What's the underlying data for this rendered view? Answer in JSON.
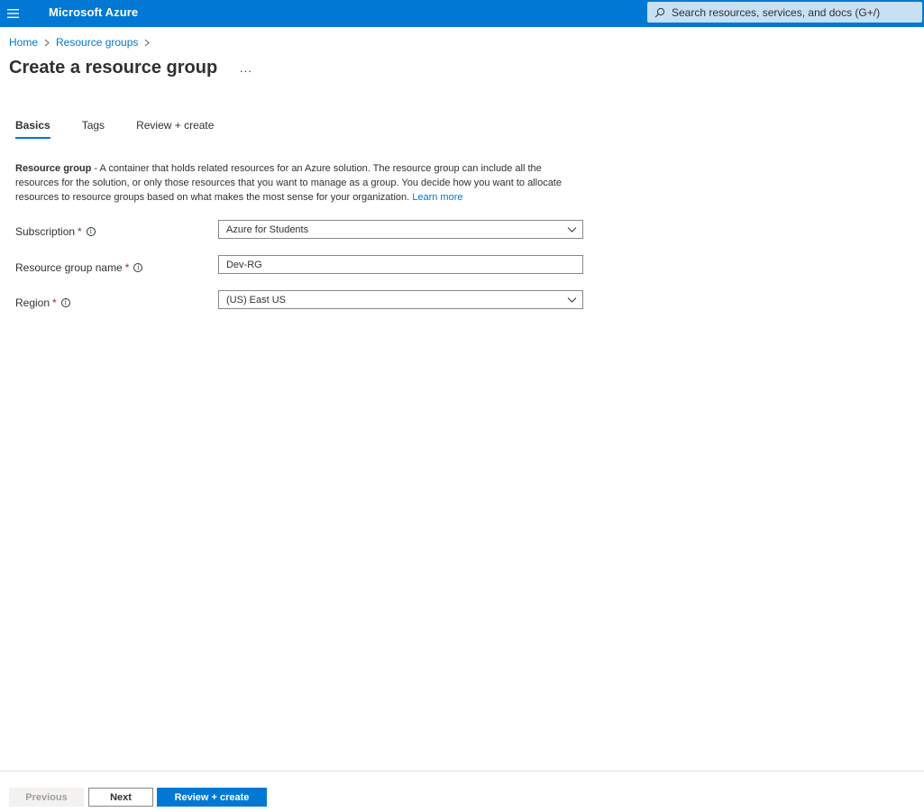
{
  "app": {
    "brand": "Microsoft Azure",
    "search_placeholder": "Search resources, services, and docs (G+/)"
  },
  "breadcrumb": {
    "items": [
      "Home",
      "Resource groups"
    ]
  },
  "page": {
    "title": "Create a resource group",
    "more_label": "..."
  },
  "tabs": [
    {
      "label": "Basics",
      "active": true
    },
    {
      "label": "Tags",
      "active": false
    },
    {
      "label": "Review + create",
      "active": false
    }
  ],
  "description": {
    "term": "Resource group",
    "text": " - A container that holds related resources for an Azure solution. The resource group can include all the resources for the solution, or only those resources that you want to manage as a group. You decide how you want to allocate resources to resource groups based on what makes the most sense for your organization. ",
    "link": "Learn more"
  },
  "form": {
    "subscription": {
      "label": "Subscription",
      "required": "*",
      "value": "Azure for Students"
    },
    "resource_group_name": {
      "label": "Resource group name",
      "required": "*",
      "value": "Dev-RG"
    },
    "region": {
      "label": "Region",
      "required": "*",
      "value": "(US) East US"
    }
  },
  "footer": {
    "previous": "Previous",
    "next": "Next",
    "review_create": "Review + create"
  },
  "colors": {
    "accent": "#0078d4",
    "required": "#a4262c",
    "search_bg": "#c7e0f4"
  },
  "icons": [
    "hamburger-icon",
    "search-icon",
    "chevron-right-icon",
    "info-icon",
    "chevron-down-icon"
  ]
}
